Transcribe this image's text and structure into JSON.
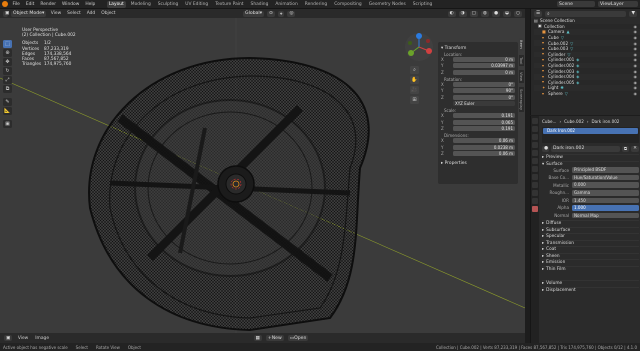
{
  "menu": {
    "items": [
      "File",
      "Edit",
      "Render",
      "Window",
      "Help"
    ]
  },
  "workspaces": [
    {
      "label": "Layout",
      "active": true
    },
    {
      "label": "Modeling"
    },
    {
      "label": "Sculpting"
    },
    {
      "label": "UV Editing"
    },
    {
      "label": "Texture Paint"
    },
    {
      "label": "Shading"
    },
    {
      "label": "Animation"
    },
    {
      "label": "Rendering"
    },
    {
      "label": "Compositing"
    },
    {
      "label": "Geometry Nodes"
    },
    {
      "label": "Scripting"
    }
  ],
  "top_right": {
    "scene": "Scene",
    "view_layer": "ViewLayer"
  },
  "viewport_header": {
    "mode": "Object Mode",
    "menus": [
      "View",
      "Select",
      "Add",
      "Object"
    ],
    "orientation": "Global",
    "options": "Options"
  },
  "stats": {
    "view": "User Perspective",
    "collection": "(2) Collection | Cube.002",
    "rows": [
      {
        "label": "Objects",
        "value": "1/2"
      },
      {
        "label": "Vertices",
        "value": "87,233,319"
      },
      {
        "label": "Edges",
        "value": "174,338,564"
      },
      {
        "label": "Faces",
        "value": "87,567,852"
      },
      {
        "label": "Triangles",
        "value": "174,975,760"
      }
    ]
  },
  "npanel": {
    "title": "Transform",
    "location_label": "Location:",
    "location": [
      {
        "k": "X",
        "v": "0 m"
      },
      {
        "k": "Y",
        "v": "0.03997 m"
      },
      {
        "k": "Z",
        "v": "0 m"
      }
    ],
    "rotation_label": "Rotation:",
    "rotation": [
      {
        "k": "X",
        "v": "0°"
      },
      {
        "k": "Y",
        "v": "90°"
      },
      {
        "k": "Z",
        "v": "0°"
      }
    ],
    "mode": "XYZ Euler",
    "scale_label": "Scale:",
    "scale": [
      {
        "k": "X",
        "v": "0.191"
      },
      {
        "k": "Y",
        "v": "0.065"
      },
      {
        "k": "Z",
        "v": "0.191"
      }
    ],
    "dimensions_label": "Dimensions:",
    "dimensions": [
      {
        "k": "X",
        "v": "0.06 m"
      },
      {
        "k": "Y",
        "v": "0.0238 m"
      },
      {
        "k": "Z",
        "v": "0.06 m"
      }
    ],
    "properties": "Properties",
    "tabs": [
      "Item",
      "Tool",
      "View",
      "Screenplay"
    ]
  },
  "footer": {
    "menus": [
      "View",
      "Image"
    ],
    "buttons": [
      "New",
      "Open"
    ]
  },
  "statusbar": {
    "left": [
      "Active object has negative scale",
      "Select",
      "Rotate View",
      "Object"
    ],
    "right": "Collection | Cube.002 | Verts 87,233,319 | Faces 87,567,852 | Tris 174,975,760 | Objects 0/12 | 4.1.0"
  },
  "outliner": {
    "title": "Scene Collection",
    "items": [
      {
        "name": "Collection",
        "indent": 0,
        "icon": "collection-icon"
      },
      {
        "name": "Camera",
        "indent": 1,
        "icon": "camera-icon"
      },
      {
        "name": "Cube",
        "indent": 1,
        "icon": "mesh-icon"
      },
      {
        "name": "Cube.002",
        "indent": 1,
        "icon": "mesh-icon"
      },
      {
        "name": "Cube.003",
        "indent": 1,
        "icon": "mesh-icon"
      },
      {
        "name": "Cylinder",
        "indent": 1,
        "icon": "mesh-icon"
      },
      {
        "name": "Cylinder.001",
        "indent": 1,
        "icon": "mesh-icon"
      },
      {
        "name": "Cylinder.002",
        "indent": 1,
        "icon": "mesh-icon"
      },
      {
        "name": "Cylinder.003",
        "indent": 1,
        "icon": "mesh-icon"
      },
      {
        "name": "Cylinder.004",
        "indent": 1,
        "icon": "mesh-icon"
      },
      {
        "name": "Cylinder.005",
        "indent": 1,
        "icon": "mesh-icon"
      },
      {
        "name": "Light",
        "indent": 1,
        "icon": "light-icon"
      },
      {
        "name": "Sphere",
        "indent": 1,
        "icon": "mesh-icon"
      }
    ]
  },
  "properties": {
    "breadcrumb": [
      "Cube...",
      "Cube.002",
      "Dark iron.002"
    ],
    "slot": "Dark Iron.002",
    "material": "Dark iron.002",
    "sections": [
      "Preview",
      "Surface"
    ],
    "surface": {
      "label": "Surface",
      "value": "Principled BSDF"
    },
    "rows": [
      {
        "k": "Base Co...",
        "v": "Hue/Saturation/Value"
      },
      {
        "k": "Metallic",
        "v": "0.000"
      },
      {
        "k": "Roughn...",
        "v": "Gamma"
      },
      {
        "k": "IOR",
        "v": "1.450"
      },
      {
        "k": "Alpha",
        "v": "1.000",
        "blue": true
      },
      {
        "k": "Normal",
        "v": "Normal Map"
      }
    ],
    "subsections": [
      "Diffuse",
      "Subsurface",
      "Specular",
      "Transmission",
      "Coat",
      "Sheen",
      "Emission",
      "Thin Film",
      "Volume",
      "Displacement"
    ]
  }
}
